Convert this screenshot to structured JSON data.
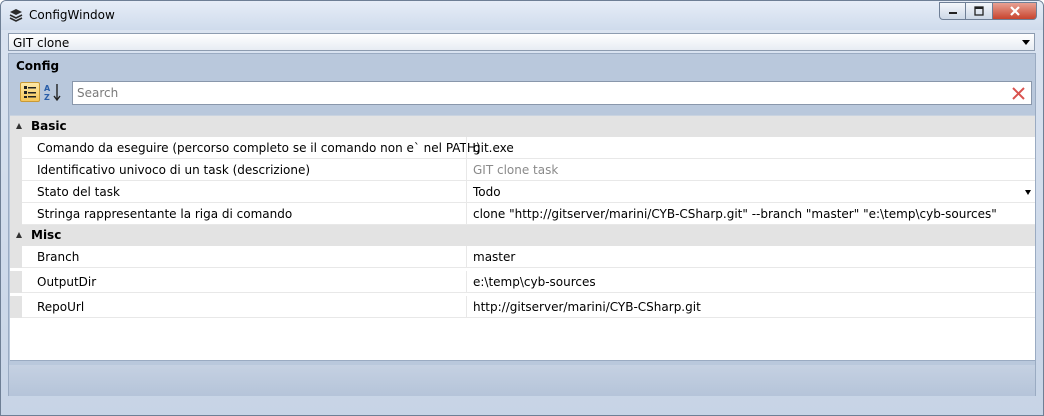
{
  "window": {
    "title": "ConfigWindow"
  },
  "selector": {
    "value": "GIT clone"
  },
  "config": {
    "label": "Config",
    "search_placeholder": "Search"
  },
  "categories": [
    {
      "name": "Basic",
      "properties": [
        {
          "name": "Comando da eseguire (percorso completo se il comando non e` nel PATH)",
          "value": "git.exe",
          "placeholder": false,
          "dropdown": false
        },
        {
          "name": "Identificativo univoco di un task (descrizione)",
          "value": "GIT clone task",
          "placeholder": true,
          "dropdown": false
        },
        {
          "name": "Stato del task",
          "value": "Todo",
          "placeholder": false,
          "dropdown": true
        },
        {
          "name": "Stringa rappresentante la riga di comando",
          "value": "clone \"http://gitserver/marini/CYB-CSharp.git\" --branch \"master\" \"e:\\temp\\cyb-sources\"",
          "placeholder": false,
          "dropdown": false
        }
      ]
    },
    {
      "name": "Misc",
      "properties": [
        {
          "name": "Branch",
          "value": "master",
          "placeholder": false,
          "dropdown": false
        },
        {
          "name": "OutputDir",
          "value": "e:\\temp\\cyb-sources",
          "placeholder": false,
          "dropdown": false
        },
        {
          "name": "RepoUrl",
          "value": "http://gitserver/marini/CYB-CSharp.git",
          "placeholder": false,
          "dropdown": false
        }
      ]
    }
  ],
  "icons": {
    "window": "stack-icon",
    "minimize": "minimize-icon",
    "maximize": "maximize-icon",
    "close": "close-icon",
    "categorized": "categorized-view-icon",
    "alphabetical": "sort-alphabetical-icon",
    "clear": "clear-search-icon"
  },
  "colors": {
    "close_button": "#c8442e",
    "clear_icon": "#d9534f",
    "category_band": "#e3e3e3"
  }
}
